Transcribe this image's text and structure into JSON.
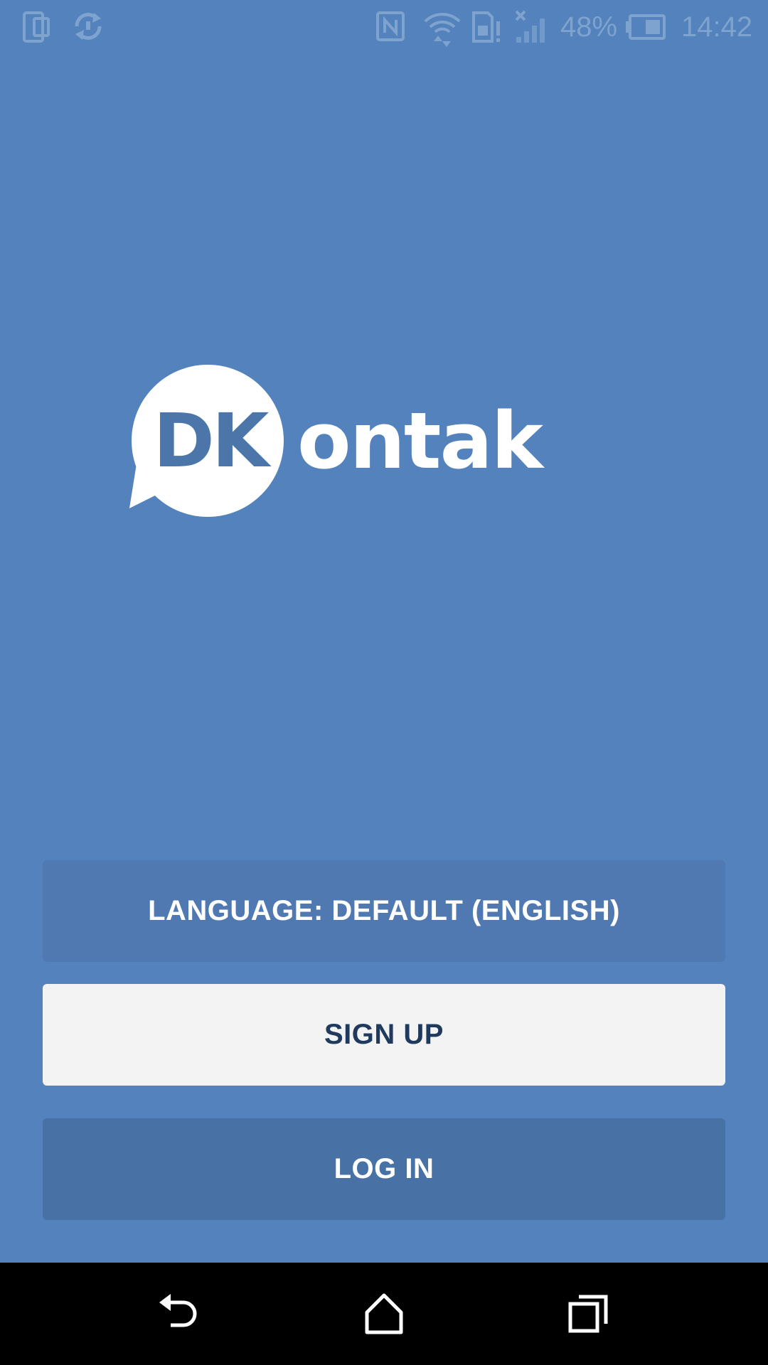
{
  "status_bar": {
    "battery_percent": "48%",
    "time": "14:42",
    "icons": [
      "phone-screen-icon",
      "sync-icon",
      "nfc-icon",
      "wifi-icon",
      "sim-alert-icon",
      "no-signal-icon",
      "battery-icon"
    ]
  },
  "logo": {
    "mark": "DK",
    "word": "ontak"
  },
  "buttons": {
    "language": "LANGUAGE: DEFAULT (ENGLISH)",
    "signup": "SIGN UP",
    "login": "LOG IN"
  },
  "nav_bar": {
    "icons": [
      "back-icon",
      "home-icon",
      "recents-icon"
    ]
  },
  "colors": {
    "background": "#5382bc",
    "language_button": "#5079b2",
    "signup_button": "#f3f3f4",
    "signup_text": "#1f3a5c",
    "login_button": "#4872a6",
    "nav_bar": "#000000"
  }
}
